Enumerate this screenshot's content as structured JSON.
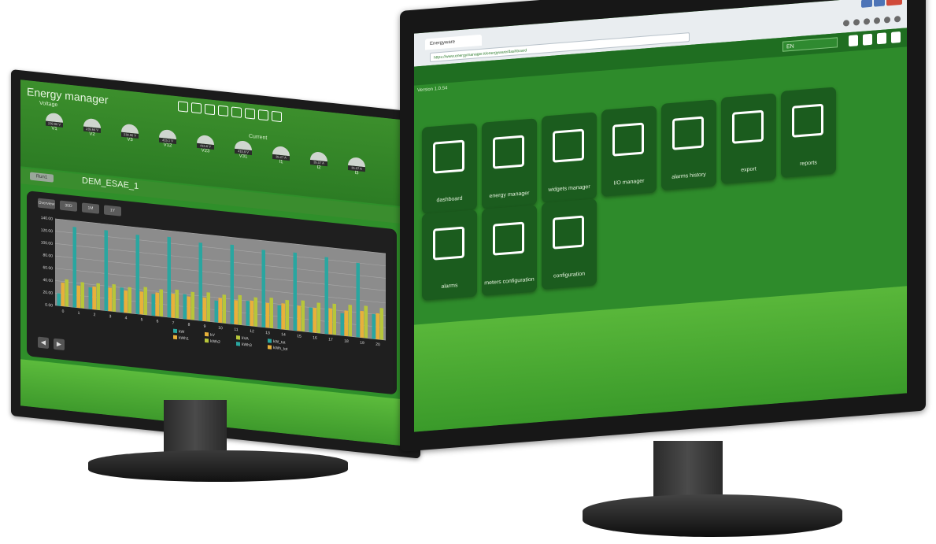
{
  "left_monitor": {
    "title": "Energy manager",
    "voltage_label": "Voltage",
    "current_label": "Current",
    "gauges": [
      {
        "label": "V1",
        "value": "239.90 V"
      },
      {
        "label": "V2",
        "value": "239.64 V"
      },
      {
        "label": "V3",
        "value": "239.90 V"
      },
      {
        "label": "V12",
        "value": "415.1 V"
      },
      {
        "label": "V23",
        "value": "415.6 V"
      },
      {
        "label": "V31",
        "value": "415.9 V"
      },
      {
        "label": "I1",
        "value": "35.27 A"
      },
      {
        "label": "I2",
        "value": "35.07 A"
      },
      {
        "label": "I3",
        "value": "35.07 A"
      }
    ],
    "badge": "Run1",
    "device_name": "DEM_ESAE_1",
    "buttons": [
      "Overview",
      "30D",
      "1M",
      "1Y"
    ],
    "nav": [
      "◀",
      "▶"
    ]
  },
  "chart_data": {
    "type": "bar",
    "categories": [
      "0",
      "1",
      "2",
      "3",
      "4",
      "5",
      "6",
      "7",
      "8",
      "9",
      "10",
      "11",
      "12",
      "13",
      "14",
      "15",
      "16",
      "17",
      "18",
      "19",
      "20"
    ],
    "ylim": [
      0,
      140
    ],
    "yticks": [
      "0.00",
      "20.00",
      "40.00",
      "60.00",
      "80.00",
      "100.00",
      "120.00",
      "140.00"
    ],
    "series": [
      {
        "name": "kW",
        "color": "#2aa6a0",
        "values": [
          20,
          130,
          35,
          130,
          40,
          128,
          35,
          130,
          40,
          126,
          35,
          128,
          40,
          125,
          38,
          126,
          40,
          124,
          36,
          120,
          40
        ]
      },
      {
        "name": "kV",
        "color": "#e8b13a",
        "values": [
          38,
          36,
          37,
          38,
          36,
          37,
          38,
          39,
          37,
          38,
          40,
          39,
          41,
          40,
          42,
          41,
          40,
          42,
          41,
          43,
          42
        ]
      },
      {
        "name": "kVA",
        "color": "#b7c63a",
        "values": [
          44,
          42,
          43,
          44,
          42,
          45,
          44,
          46,
          45,
          47,
          46,
          48,
          47,
          49,
          48,
          50,
          49,
          50,
          51,
          52,
          51
        ]
      }
    ],
    "legend": [
      "kW",
      "kV",
      "kVA",
      "kW_tot",
      "kWh1",
      "kWh2",
      "kWh3",
      "kWh_tot"
    ]
  },
  "right_monitor": {
    "tab_title": "Energyware",
    "url": "https://www.energymanager.it/energyware/dashboard",
    "language": "EN",
    "version": "Version 1.0.54",
    "tiles": [
      {
        "label": "dashboard",
        "icon": "dashboard-icon"
      },
      {
        "label": "energy manager",
        "icon": "trend-chart-icon"
      },
      {
        "label": "widgets manager",
        "icon": "widget-star-icon"
      },
      {
        "label": "I/O manager",
        "icon": "io-arrows-icon"
      },
      {
        "label": "alarms history",
        "icon": "alarm-mail-icon"
      },
      {
        "label": "export",
        "icon": "export-icon"
      },
      {
        "label": "reports",
        "icon": "report-icon"
      },
      {
        "label": "alarms",
        "icon": "alarm-gear-icon"
      },
      {
        "label": "meters configuration",
        "icon": "database-gear-icon"
      },
      {
        "label": "configuration",
        "icon": "gears-icon"
      }
    ]
  }
}
